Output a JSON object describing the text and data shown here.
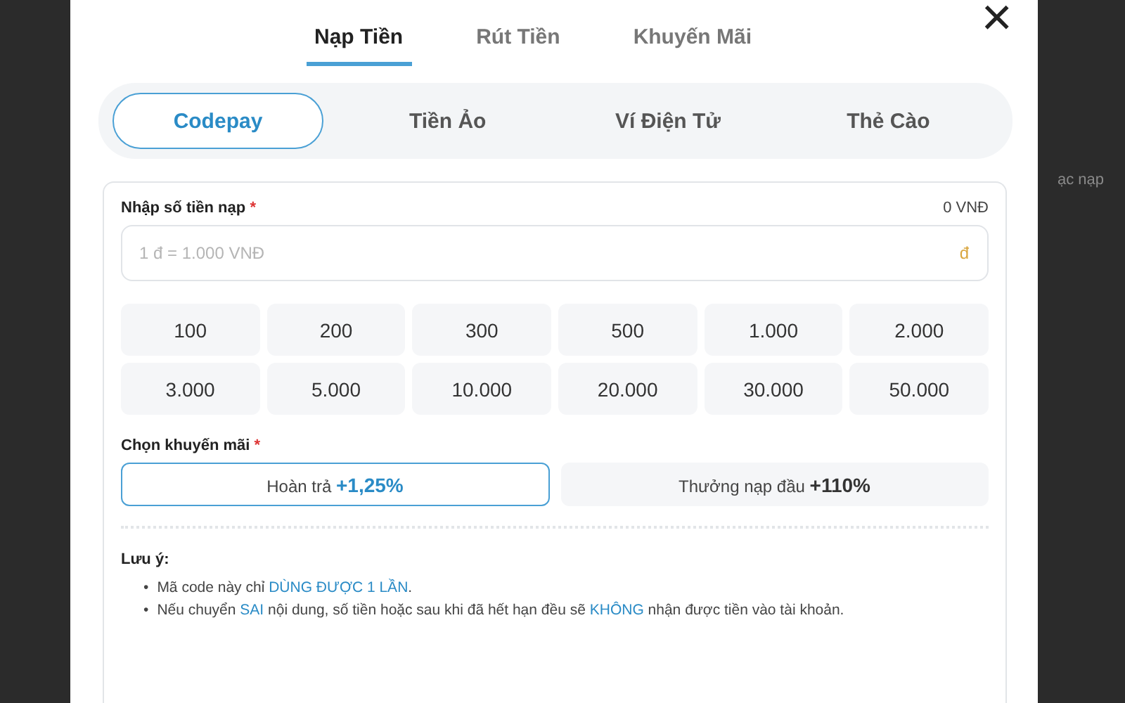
{
  "background": {
    "text": "ạc nạp"
  },
  "tabs": [
    {
      "label": "Nạp Tiền",
      "selected": true
    },
    {
      "label": "Rút Tiền",
      "selected": false
    },
    {
      "label": "Khuyến Mãi",
      "selected": false
    }
  ],
  "close": "×",
  "methods": [
    {
      "label": "Codepay",
      "selected": true
    },
    {
      "label": "Tiền Ảo",
      "selected": false
    },
    {
      "label": "Ví Điện Tử",
      "selected": false
    },
    {
      "label": "Thẻ Cào",
      "selected": false
    }
  ],
  "amount": {
    "label": "Nhập số tiền nạp",
    "required": "*",
    "total": "0 VNĐ",
    "placeholder": "1 đ = 1.000 VNĐ",
    "unit": "đ"
  },
  "presets": [
    "100",
    "200",
    "300",
    "500",
    "1.000",
    "2.000",
    "3.000",
    "5.000",
    "10.000",
    "20.000",
    "30.000",
    "50.000"
  ],
  "promo": {
    "label": "Chọn khuyến mãi",
    "required": "*",
    "options": [
      {
        "label": "Hoàn trả",
        "bonus": "+1,25%",
        "selected": true
      },
      {
        "label": "Thưởng nạp đầu",
        "bonus": "+110%",
        "selected": false
      }
    ]
  },
  "notes": {
    "title": "Lưu ý:",
    "bullet": "•",
    "items": [
      [
        {
          "text": "Mã code này chỉ ",
          "highlight": false
        },
        {
          "text": "DÙNG ĐƯỢC 1 LẦN",
          "highlight": true
        },
        {
          "text": ".",
          "highlight": false
        }
      ],
      [
        {
          "text": "Nếu chuyển ",
          "highlight": false
        },
        {
          "text": "SAI",
          "highlight": true
        },
        {
          "text": " nội dung, số tiền hoặc sau khi đã hết hạn đều sẽ ",
          "highlight": false
        },
        {
          "text": "KHÔNG",
          "highlight": true
        },
        {
          "text": " nhận được tiền vào tài khoản.",
          "highlight": false
        }
      ]
    ]
  }
}
